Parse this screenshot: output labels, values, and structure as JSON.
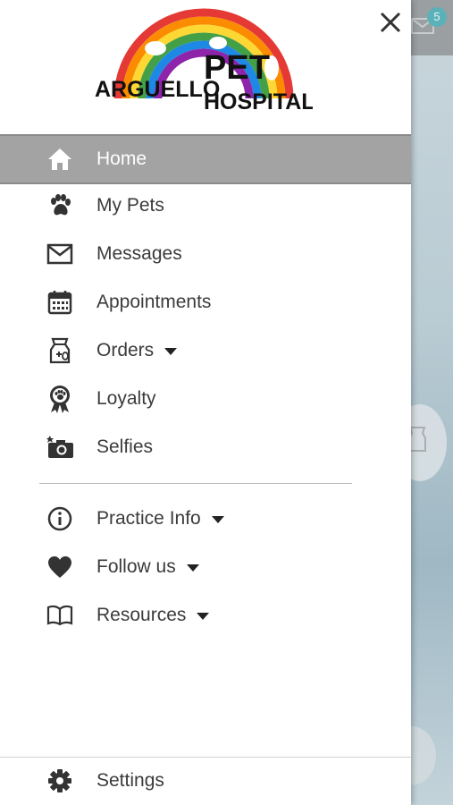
{
  "background": {
    "notification_count": "5"
  },
  "drawer": {
    "logo": {
      "line1": "ARGUELLO",
      "line2": "PET",
      "line3": "HOSPITAL"
    },
    "menu": [
      {
        "label": "Home",
        "icon": "home-icon",
        "active": true
      },
      {
        "label": "My Pets",
        "icon": "paw-icon"
      },
      {
        "label": "Messages",
        "icon": "envelope-icon"
      },
      {
        "label": "Appointments",
        "icon": "calendar-icon"
      },
      {
        "label": "Orders",
        "icon": "pet-food-bag-icon",
        "dropdown": true
      },
      {
        "label": "Loyalty",
        "icon": "ribbon-award-icon"
      },
      {
        "label": "Selfies",
        "icon": "camera-icon"
      }
    ],
    "secondary_menu": [
      {
        "label": "Practice Info",
        "icon": "info-icon",
        "dropdown": true
      },
      {
        "label": "Follow us",
        "icon": "heart-icon",
        "dropdown": true
      },
      {
        "label": "Resources",
        "icon": "book-icon",
        "dropdown": true
      }
    ],
    "footer": {
      "label": "Settings",
      "icon": "gear-icon"
    }
  },
  "colors": {
    "active_bg": "#a3a3a3",
    "text": "#3b3b3b",
    "badge": "#5ab2b8"
  }
}
